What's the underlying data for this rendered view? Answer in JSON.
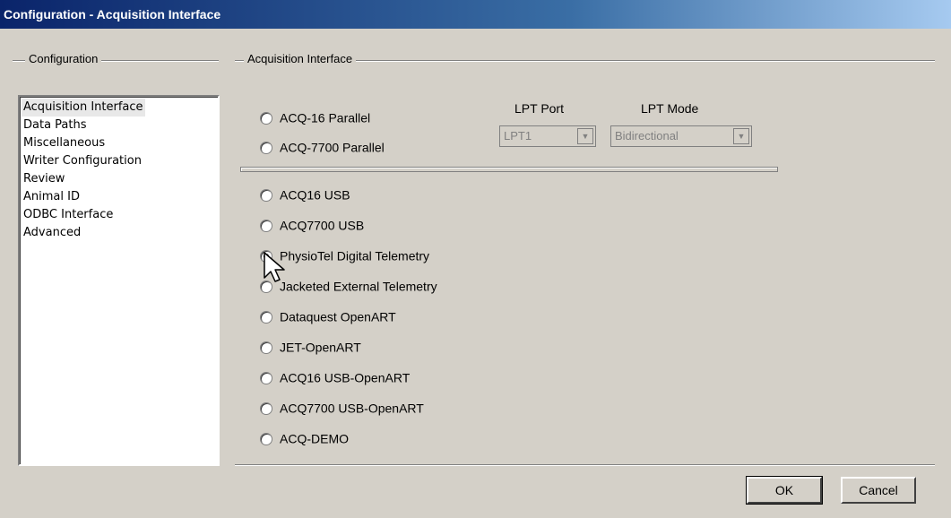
{
  "window": {
    "title": "Configuration - Acquisition Interface"
  },
  "left_group": {
    "label": "Configuration",
    "items": [
      {
        "label": "Acquisition Interface",
        "selected": true
      },
      {
        "label": "Data Paths"
      },
      {
        "label": "Miscellaneous"
      },
      {
        "label": "Writer Configuration"
      },
      {
        "label": "Review"
      },
      {
        "label": "Animal ID"
      },
      {
        "label": "ODBC Interface"
      },
      {
        "label": "Advanced"
      }
    ]
  },
  "right_group": {
    "label": "Acquisition Interface",
    "lpt_port": {
      "label": "LPT Port",
      "value": "LPT1"
    },
    "lpt_mode": {
      "label": "LPT Mode",
      "value": "Bidirectional"
    },
    "parallel_options": [
      {
        "label": "ACQ-16 Parallel",
        "checked": false
      },
      {
        "label": "ACQ-7700 Parallel",
        "checked": false
      }
    ],
    "options": [
      {
        "label": "ACQ16 USB",
        "checked": false
      },
      {
        "label": "ACQ7700 USB",
        "checked": false
      },
      {
        "label": "PhysioTel Digital Telemetry",
        "checked": true
      },
      {
        "label": "Jacketed External Telemetry",
        "checked": false
      },
      {
        "label": "Dataquest OpenART",
        "checked": false
      },
      {
        "label": "JET-OpenART",
        "checked": false
      },
      {
        "label": "ACQ16 USB-OpenART",
        "checked": false
      },
      {
        "label": "ACQ7700 USB-OpenART",
        "checked": false
      },
      {
        "label": "ACQ-DEMO",
        "checked": false
      }
    ]
  },
  "buttons": {
    "ok": "OK",
    "cancel": "Cancel"
  },
  "icons": {
    "dropdown": "chevron-down-icon",
    "cursor": "mouse-pointer-icon"
  },
  "colors": {
    "titlebar_start": "#0a246a",
    "titlebar_end": "#a6caf0",
    "dialog_bg": "#d4d0c8"
  }
}
